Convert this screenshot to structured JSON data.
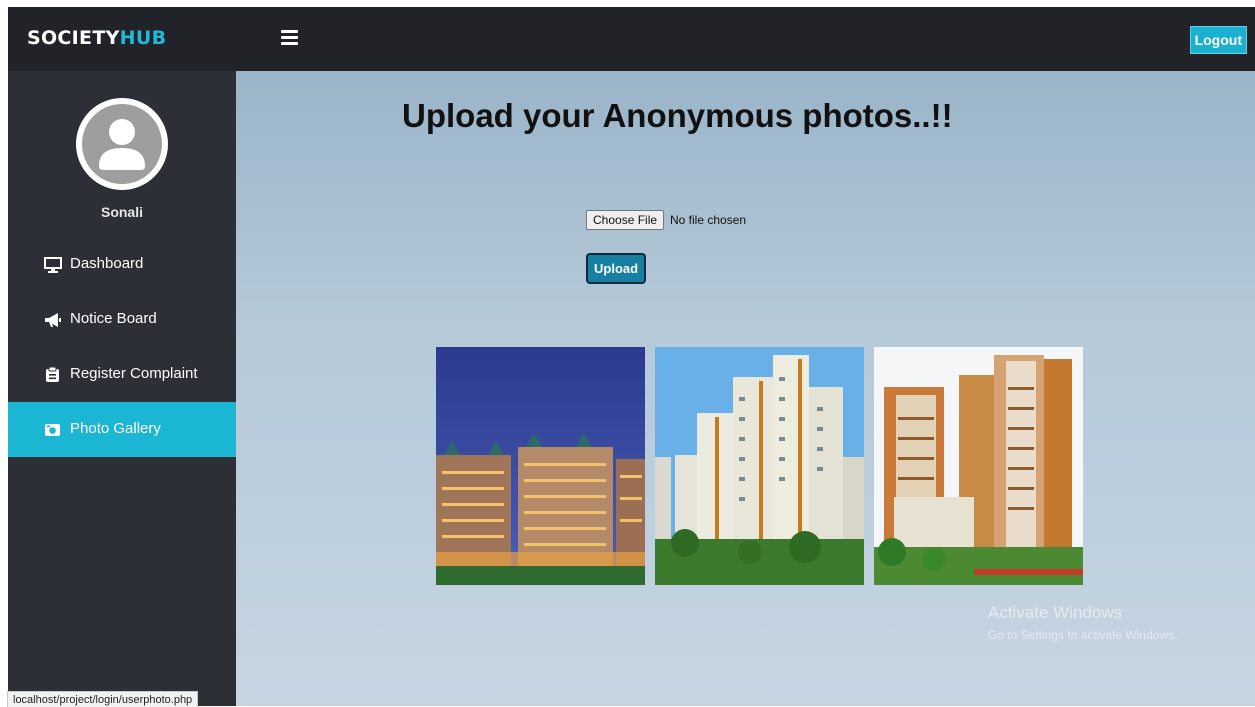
{
  "header": {
    "brand_part1": "SOCIETY",
    "brand_part2": "HUB",
    "logout_label": "Logout"
  },
  "sidebar": {
    "user_name": "Sonali",
    "items": [
      {
        "label": "Dashboard",
        "icon": "monitor-icon"
      },
      {
        "label": "Notice Board",
        "icon": "megaphone-icon"
      },
      {
        "label": "Register Complaint",
        "icon": "complaint-icon"
      },
      {
        "label": "Photo Gallery",
        "icon": "camera-icon",
        "active": true
      }
    ]
  },
  "main": {
    "title": "Upload your Anonymous photos..!!",
    "choose_file_label": "Choose File",
    "file_status": "No file chosen",
    "upload_label": "Upload"
  },
  "watermark": {
    "line1": "Activate Windows",
    "line2": "Go to Settings to activate Windows."
  },
  "status_bar": {
    "url": "localhost/project/login/userphoto.php"
  },
  "colors": {
    "accent": "#1ab6d4",
    "topbar": "#222328",
    "sidebar": "#2d2f37",
    "upload_button": "#177fa1"
  }
}
